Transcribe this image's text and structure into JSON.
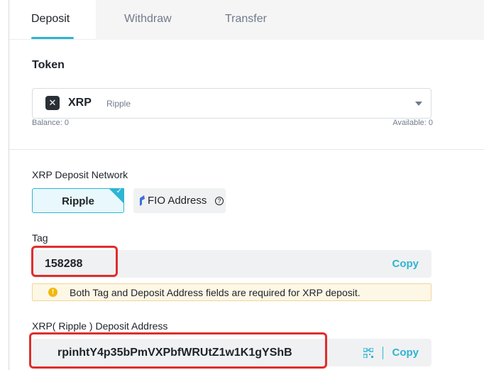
{
  "tabs": [
    {
      "label": "Deposit",
      "active": true
    },
    {
      "label": "Withdraw",
      "active": false
    },
    {
      "label": "Transfer",
      "active": false
    }
  ],
  "token": {
    "section_label": "Token",
    "icon": "xrp-logo-icon",
    "symbol": "XRP",
    "name": "Ripple",
    "balance_text": "Balance: 0",
    "available_text": "Available: 0"
  },
  "network": {
    "title": "XRP Deposit Network",
    "options": [
      {
        "label": "Ripple",
        "selected": true
      },
      {
        "label": "FIO Address",
        "selected": false
      }
    ],
    "help_icon": "question-circle-icon"
  },
  "tag": {
    "label": "Tag",
    "value": "158288",
    "copy_label": "Copy"
  },
  "warning": {
    "text": "Both Tag and Deposit Address fields are required for XRP deposit."
  },
  "address": {
    "label": "XRP( Ripple ) Deposit Address",
    "value": "rpinhtY4p35bPmVXPbfWRUtZ1w1K1gYShB",
    "copy_label": "Copy",
    "qr_icon": "qr-code-icon"
  },
  "colors": {
    "accent": "#2db5d3",
    "highlight_border": "#e12d2d",
    "warning_bg": "#fdf7e5",
    "warning_icon": "#f0b90b"
  }
}
